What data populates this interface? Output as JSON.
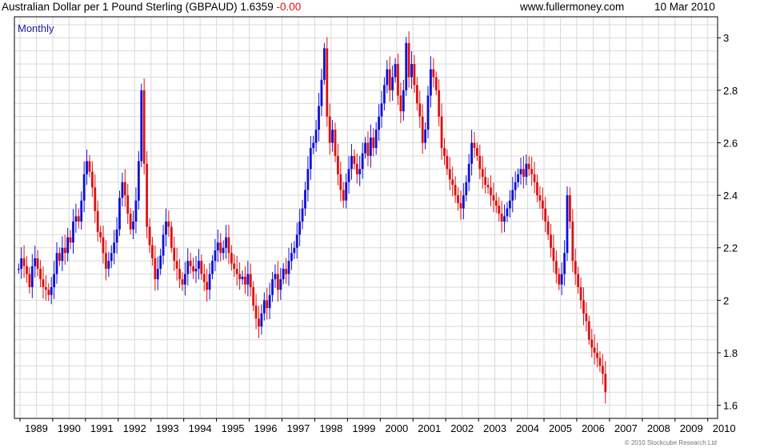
{
  "header": {
    "title": "Australian Dollar per 1 Pound Sterling (GBPAUD)",
    "last_value": "1.6359",
    "change": "-0.00",
    "website": "www.fullermoney.com",
    "date": "10 Mar 2010"
  },
  "footer": {
    "copyright": "© 2010 Stockcube Research Ltd"
  },
  "colors": {
    "up": "#1010d8",
    "down": "#e01010",
    "grid": "#d9d9d9",
    "frame": "#000000",
    "period_label": "#1a1aa0"
  },
  "chart_data": {
    "type": "candlestick",
    "period": "Monthly",
    "x_ticks": [
      "1989",
      "1990",
      "1991",
      "1992",
      "1993",
      "1994",
      "1995",
      "1996",
      "1997",
      "1998",
      "1999",
      "2000",
      "2001",
      "2002",
      "2003",
      "2004",
      "2005",
      "2006",
      "2007",
      "2008",
      "2009",
      "2010"
    ],
    "y_ticks": [
      1.6,
      1.8,
      2.0,
      2.2,
      2.4,
      2.6,
      2.8,
      3.0
    ],
    "ylim": [
      1.55,
      3.08
    ],
    "xlim": [
      1988.83,
      2010.3
    ],
    "y_axis_position": "right",
    "grid": true,
    "monthly_close": [
      2.12,
      2.16,
      2.13,
      2.1,
      2.05,
      2.13,
      2.16,
      2.12,
      2.08,
      2.05,
      2.04,
      2.02,
      2.05,
      2.1,
      2.18,
      2.15,
      2.2,
      2.18,
      2.24,
      2.22,
      2.3,
      2.32,
      2.3,
      2.38,
      2.48,
      2.53,
      2.49,
      2.43,
      2.34,
      2.26,
      2.24,
      2.18,
      2.12,
      2.15,
      2.18,
      2.22,
      2.27,
      2.39,
      2.45,
      2.4,
      2.33,
      2.27,
      2.3,
      2.38,
      2.53,
      2.8,
      2.52,
      2.28,
      2.21,
      2.16,
      2.08,
      2.12,
      2.17,
      2.25,
      2.3,
      2.28,
      2.2,
      2.15,
      2.12,
      2.08,
      2.06,
      2.1,
      2.15,
      2.13,
      2.11,
      2.12,
      2.15,
      2.1,
      2.07,
      2.04,
      2.1,
      2.15,
      2.19,
      2.22,
      2.18,
      2.2,
      2.24,
      2.18,
      2.14,
      2.12,
      2.1,
      2.08,
      2.09,
      2.06,
      2.1,
      2.05,
      1.98,
      1.93,
      1.9,
      1.95,
      2.0,
      1.97,
      2.02,
      2.08,
      2.1,
      2.04,
      2.08,
      2.12,
      2.1,
      2.15,
      2.18,
      2.2,
      2.25,
      2.3,
      2.35,
      2.42,
      2.5,
      2.58,
      2.6,
      2.65,
      2.74,
      2.84,
      2.96,
      2.7,
      2.6,
      2.65,
      2.55,
      2.48,
      2.42,
      2.38,
      2.45,
      2.5,
      2.55,
      2.52,
      2.48,
      2.5,
      2.56,
      2.6,
      2.55,
      2.62,
      2.58,
      2.65,
      2.7,
      2.75,
      2.82,
      2.88,
      2.8,
      2.85,
      2.9,
      2.78,
      2.72,
      2.8,
      2.98,
      2.85,
      2.9,
      2.82,
      2.75,
      2.7,
      2.6,
      2.65,
      2.78,
      2.88,
      2.85,
      2.8,
      2.7,
      2.58,
      2.55,
      2.5,
      2.46,
      2.44,
      2.4,
      2.37,
      2.35,
      2.4,
      2.45,
      2.52,
      2.6,
      2.58,
      2.55,
      2.5,
      2.47,
      2.44,
      2.43,
      2.4,
      2.38,
      2.36,
      2.33,
      2.3,
      2.32,
      2.35,
      2.38,
      2.42,
      2.45,
      2.48,
      2.5,
      2.47,
      2.52,
      2.5,
      2.48,
      2.45,
      2.4,
      2.38,
      2.35,
      2.3,
      2.25,
      2.2,
      2.15,
      2.1,
      2.06,
      2.1,
      2.18,
      2.4,
      2.3,
      2.15,
      2.1,
      2.05,
      2.0,
      1.95,
      1.92,
      1.85,
      1.82,
      1.8,
      1.78,
      1.75,
      1.72,
      1.65
    ]
  }
}
